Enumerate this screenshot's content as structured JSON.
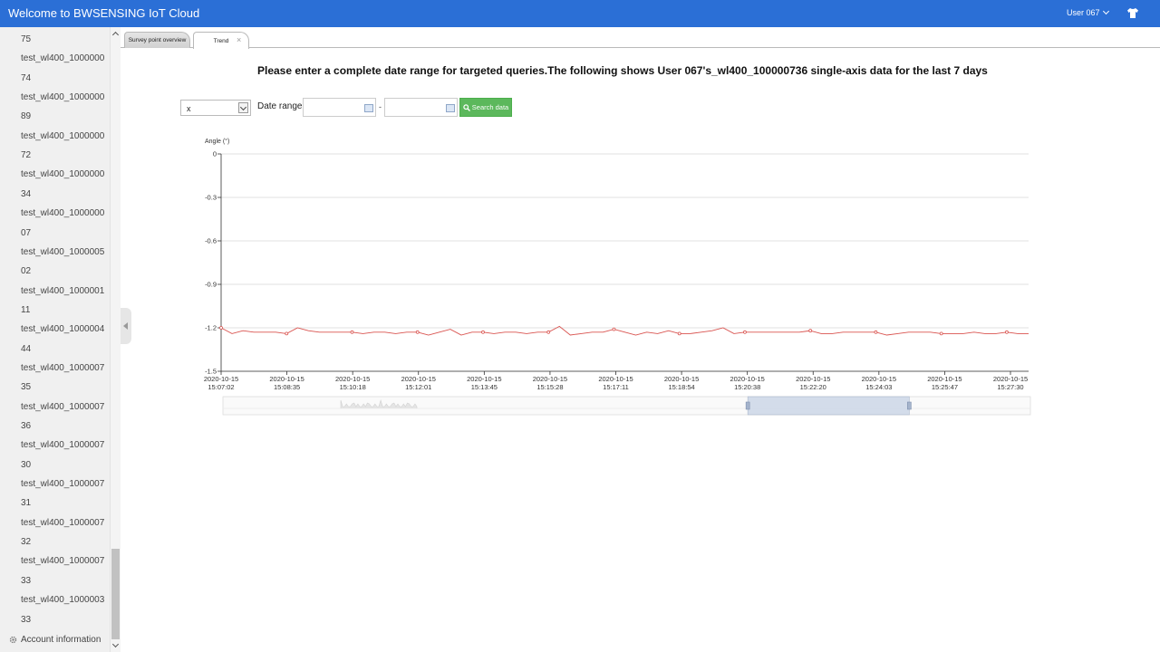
{
  "app": {
    "title": "Welcome to BWSENSING IoT Cloud",
    "user": "User 067"
  },
  "sidebar": {
    "lines": [
      "75",
      "test_wl400_1000000",
      "74",
      "test_wl400_1000000",
      "89",
      "test_wl400_1000000",
      "72",
      "test_wl400_1000000",
      "34",
      "test_wl400_1000000",
      "07",
      "test_wl400_1000005",
      "02",
      "test_wl400_1000001",
      "11",
      "test_wl400_1000004",
      "44",
      "test_wl400_1000007",
      "35",
      "test_wl400_1000007",
      "36",
      "test_wl400_1000007",
      "30",
      "test_wl400_1000007",
      "31",
      "test_wl400_1000007",
      "32",
      "test_wl400_1000007",
      "33",
      "test_wl400_1000003",
      "33"
    ],
    "account_label": "Account information"
  },
  "tabs": [
    {
      "label": "Survey point overview"
    },
    {
      "label": "Trend"
    }
  ],
  "heading": "Please enter a complete date range for targeted queries.The following shows User 067's_wl400_100000736 single-axis data for the last 7 days",
  "filter": {
    "axis_value": "x",
    "date_range_label": "Date range:",
    "start_value": "",
    "end_value": "",
    "separator": "-",
    "search_label": "Search data"
  },
  "colors": {
    "topbar": "#2b6fd6",
    "series": "#d9534f",
    "search_button": "#5cb85c"
  },
  "chart_data": {
    "type": "line",
    "ylabel": "Angle (°)",
    "ylim": [
      -1.5,
      0
    ],
    "yticks": [
      "0",
      "-0.3",
      "-0.6",
      "-0.9",
      "-1.2",
      "-1.5"
    ],
    "x_tick_labels": [
      [
        "2020-10-15",
        "15:07:02"
      ],
      [
        "2020-10-15",
        "15:08:35"
      ],
      [
        "2020-10-15",
        "15:10:18"
      ],
      [
        "2020-10-15",
        "15:12:01"
      ],
      [
        "2020-10-15",
        "15:13:45"
      ],
      [
        "2020-10-15",
        "15:15:28"
      ],
      [
        "2020-10-15",
        "15:17:11"
      ],
      [
        "2020-10-15",
        "15:18:54"
      ],
      [
        "2020-10-15",
        "15:20:38"
      ],
      [
        "2020-10-15",
        "15:22:20"
      ],
      [
        "2020-10-15",
        "15:24:03"
      ],
      [
        "2020-10-15",
        "15:25:47"
      ],
      [
        "2020-10-15",
        "15:27:30"
      ]
    ],
    "grid": true,
    "series": [
      {
        "values": [
          -1.2,
          -1.24,
          -1.22,
          -1.23,
          -1.23,
          -1.23,
          -1.24,
          -1.2,
          -1.22,
          -1.23,
          -1.23,
          -1.23,
          -1.23,
          -1.24,
          -1.23,
          -1.23,
          -1.24,
          -1.23,
          -1.23,
          -1.25,
          -1.23,
          -1.21,
          -1.25,
          -1.23,
          -1.23,
          -1.24,
          -1.23,
          -1.23,
          -1.24,
          -1.23,
          -1.23,
          -1.19,
          -1.25,
          -1.24,
          -1.23,
          -1.23,
          -1.21,
          -1.23,
          -1.25,
          -1.23,
          -1.24,
          -1.22,
          -1.24,
          -1.24,
          -1.23,
          -1.22,
          -1.2,
          -1.24,
          -1.23,
          -1.23,
          -1.23,
          -1.23,
          -1.23,
          -1.23,
          -1.22,
          -1.24,
          -1.24,
          -1.23,
          -1.23,
          -1.23,
          -1.23,
          -1.25,
          -1.24,
          -1.23,
          -1.23,
          -1.23,
          -1.24,
          -1.24,
          -1.24,
          -1.23,
          -1.24,
          -1.24,
          -1.23,
          -1.24,
          -1.24
        ]
      }
    ],
    "data_zoom": {
      "start": 0.65,
      "end": 0.85
    },
    "toolbox_icons": [
      "zoom-icon",
      "zoom-reset-icon",
      "restore-icon",
      "download-icon"
    ]
  }
}
